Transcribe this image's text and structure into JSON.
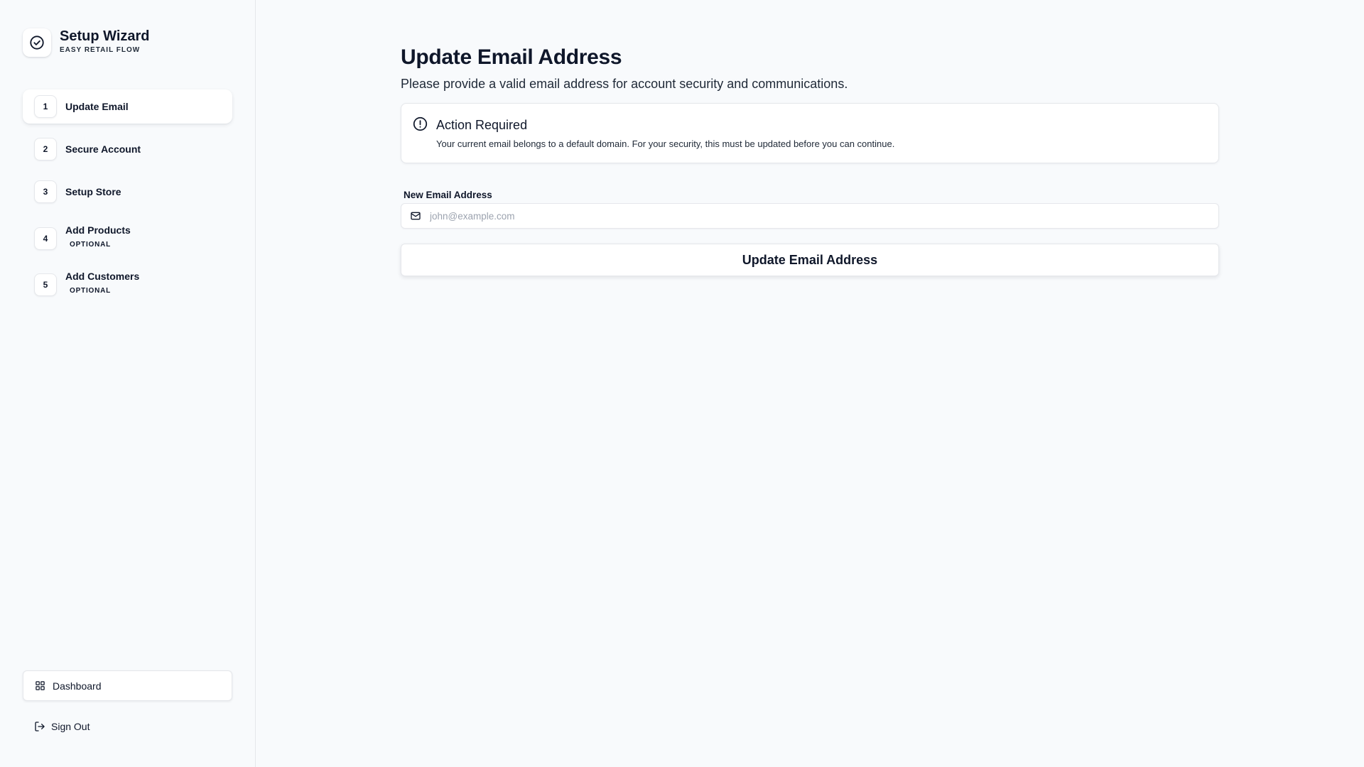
{
  "brand": {
    "title": "Setup Wizard",
    "subtitle": "EASY RETAIL FLOW",
    "icon": "check-circle-icon"
  },
  "steps": [
    {
      "number": "1",
      "label": "Update Email",
      "tag": "",
      "active": true
    },
    {
      "number": "2",
      "label": "Secure Account",
      "tag": "",
      "active": false
    },
    {
      "number": "3",
      "label": "Setup Store",
      "tag": "",
      "active": false
    },
    {
      "number": "4",
      "label": "Add Products",
      "tag": "OPTIONAL",
      "active": false
    },
    {
      "number": "5",
      "label": "Add Customers",
      "tag": "OPTIONAL",
      "active": false
    }
  ],
  "sidebar_bottom": {
    "dashboard_label": "Dashboard",
    "dashboard_icon": "grid-icon",
    "signout_label": "Sign Out",
    "signout_icon": "logout-icon"
  },
  "main": {
    "title": "Update Email Address",
    "subtitle": "Please provide a valid email address for account security and communications.",
    "alert": {
      "icon": "alert-circle-icon",
      "title": "Action Required",
      "text": "Your current email belongs to a default domain. For your security, this must be updated before you can continue."
    },
    "field": {
      "label": "New Email Address",
      "placeholder": "john@example.com",
      "value": "",
      "icon": "mail-icon"
    },
    "submit_label": "Update Email Address"
  },
  "colors": {
    "background": "#f8fafc",
    "surface": "#ffffff",
    "border": "#e5e7eb",
    "text": "#0f172a",
    "placeholder": "#9ca3af"
  }
}
